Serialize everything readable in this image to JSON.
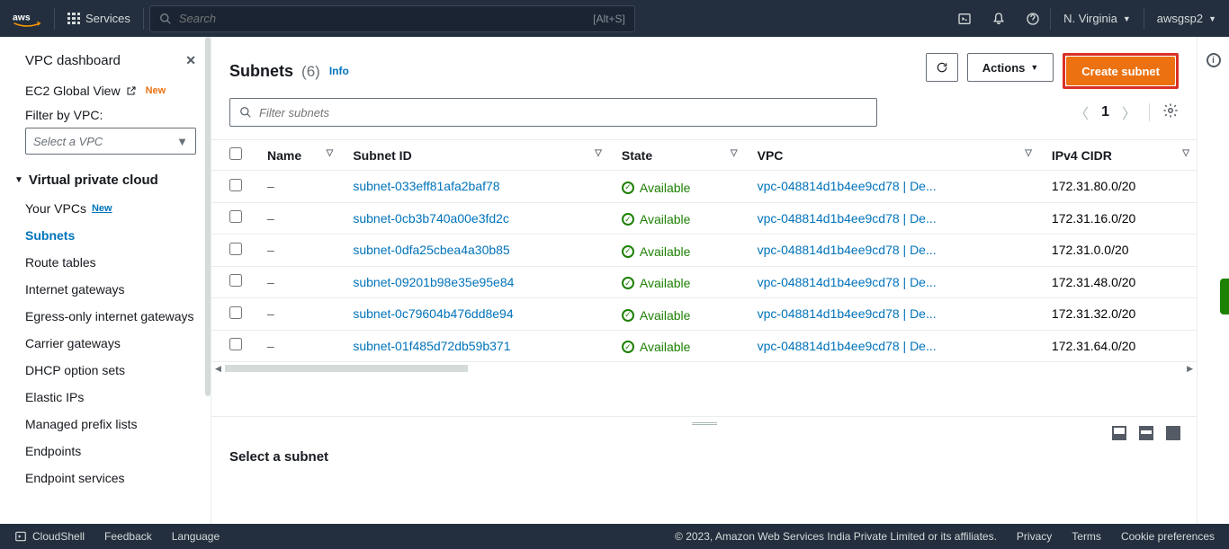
{
  "topnav": {
    "services_label": "Services",
    "search_placeholder": "Search",
    "search_shortcut": "[Alt+S]",
    "region": "N. Virginia",
    "user": "awsgsp2"
  },
  "sidebar": {
    "dashboard": "VPC dashboard",
    "ec2_global": "EC2 Global View",
    "ec2_global_badge": "New",
    "filter_label": "Filter by VPC:",
    "select_placeholder": "Select a VPC",
    "group_title": "Virtual private cloud",
    "items": [
      {
        "label": "Your VPCs",
        "new": true
      },
      {
        "label": "Subnets",
        "active": true
      },
      {
        "label": "Route tables"
      },
      {
        "label": "Internet gateways"
      },
      {
        "label": "Egress-only internet gateways"
      },
      {
        "label": "Carrier gateways"
      },
      {
        "label": "DHCP option sets"
      },
      {
        "label": "Elastic IPs"
      },
      {
        "label": "Managed prefix lists"
      },
      {
        "label": "Endpoints"
      },
      {
        "label": "Endpoint services"
      }
    ]
  },
  "header": {
    "title": "Subnets",
    "count": "(6)",
    "info": "Info",
    "actions_label": "Actions",
    "create_label": "Create subnet"
  },
  "filter": {
    "placeholder": "Filter subnets",
    "page": "1"
  },
  "table": {
    "columns": [
      "Name",
      "Subnet ID",
      "State",
      "VPC",
      "IPv4 CIDR"
    ],
    "rows": [
      {
        "name": "–",
        "subnet_id": "subnet-033eff81afa2baf78",
        "state": "Available",
        "vpc": "vpc-048814d1b4ee9cd78 | De...",
        "cidr": "172.31.80.0/20"
      },
      {
        "name": "–",
        "subnet_id": "subnet-0cb3b740a00e3fd2c",
        "state": "Available",
        "vpc": "vpc-048814d1b4ee9cd78 | De...",
        "cidr": "172.31.16.0/20"
      },
      {
        "name": "–",
        "subnet_id": "subnet-0dfa25cbea4a30b85",
        "state": "Available",
        "vpc": "vpc-048814d1b4ee9cd78 | De...",
        "cidr": "172.31.0.0/20"
      },
      {
        "name": "–",
        "subnet_id": "subnet-09201b98e35e95e84",
        "state": "Available",
        "vpc": "vpc-048814d1b4ee9cd78 | De...",
        "cidr": "172.31.48.0/20"
      },
      {
        "name": "–",
        "subnet_id": "subnet-0c79604b476dd8e94",
        "state": "Available",
        "vpc": "vpc-048814d1b4ee9cd78 | De...",
        "cidr": "172.31.32.0/20"
      },
      {
        "name": "–",
        "subnet_id": "subnet-01f485d72db59b371",
        "state": "Available",
        "vpc": "vpc-048814d1b4ee9cd78 | De...",
        "cidr": "172.31.64.0/20"
      }
    ]
  },
  "detail": {
    "placeholder": "Select a subnet"
  },
  "footer": {
    "cloudshell": "CloudShell",
    "feedback": "Feedback",
    "language": "Language",
    "copyright": "© 2023, Amazon Web Services India Private Limited or its affiliates.",
    "privacy": "Privacy",
    "terms": "Terms",
    "cookies": "Cookie preferences"
  }
}
